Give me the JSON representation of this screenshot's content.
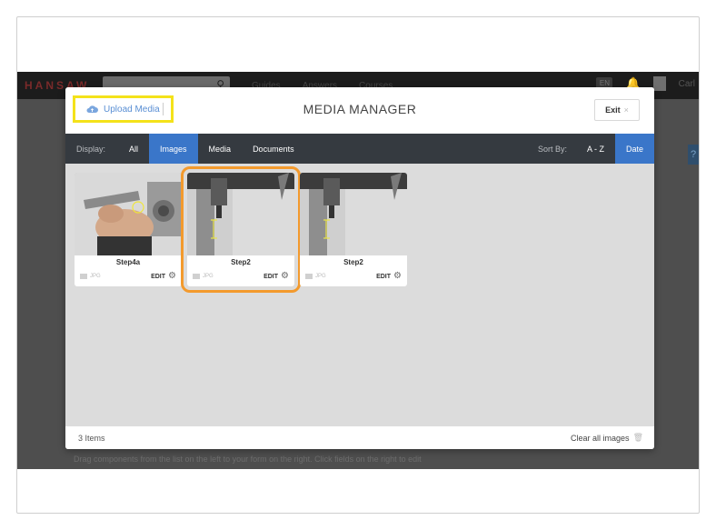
{
  "app": {
    "brand": "HANSAW",
    "nav": [
      "Guides",
      "Answers",
      "Courses"
    ],
    "lang": "EN",
    "user": "Carl",
    "help": "?",
    "under_text": "Drag components from the list on the left to your form on the right. Click fields on the right to edit"
  },
  "modal": {
    "upload_label": "Upload Media",
    "title": "MEDIA MANAGER",
    "exit_label": "Exit",
    "exit_x": "×"
  },
  "toolbar": {
    "display_label": "Display:",
    "filters": [
      {
        "label": "All",
        "active": false
      },
      {
        "label": "Images",
        "active": true
      },
      {
        "label": "Media",
        "active": false
      },
      {
        "label": "Documents",
        "active": false
      }
    ],
    "sort_label": "Sort By:",
    "sorts": [
      {
        "label": "A - Z",
        "active": false
      },
      {
        "label": "Date",
        "active": true
      }
    ]
  },
  "items": [
    {
      "name": "Step4a",
      "type": "JPG",
      "edit": "EDIT",
      "selected": false
    },
    {
      "name": "Step2",
      "type": "JPG",
      "edit": "EDIT",
      "selected": true
    },
    {
      "name": "Step2",
      "type": "JPG",
      "edit": "EDIT",
      "selected": false
    }
  ],
  "footer": {
    "count": "3 Items",
    "clear": "Clear all images"
  },
  "colors": {
    "highlight_yellow": "#f4e21a",
    "highlight_orange": "#f39a2d",
    "accent_blue": "#3a76c9",
    "toolbar_dark": "#353a40"
  }
}
